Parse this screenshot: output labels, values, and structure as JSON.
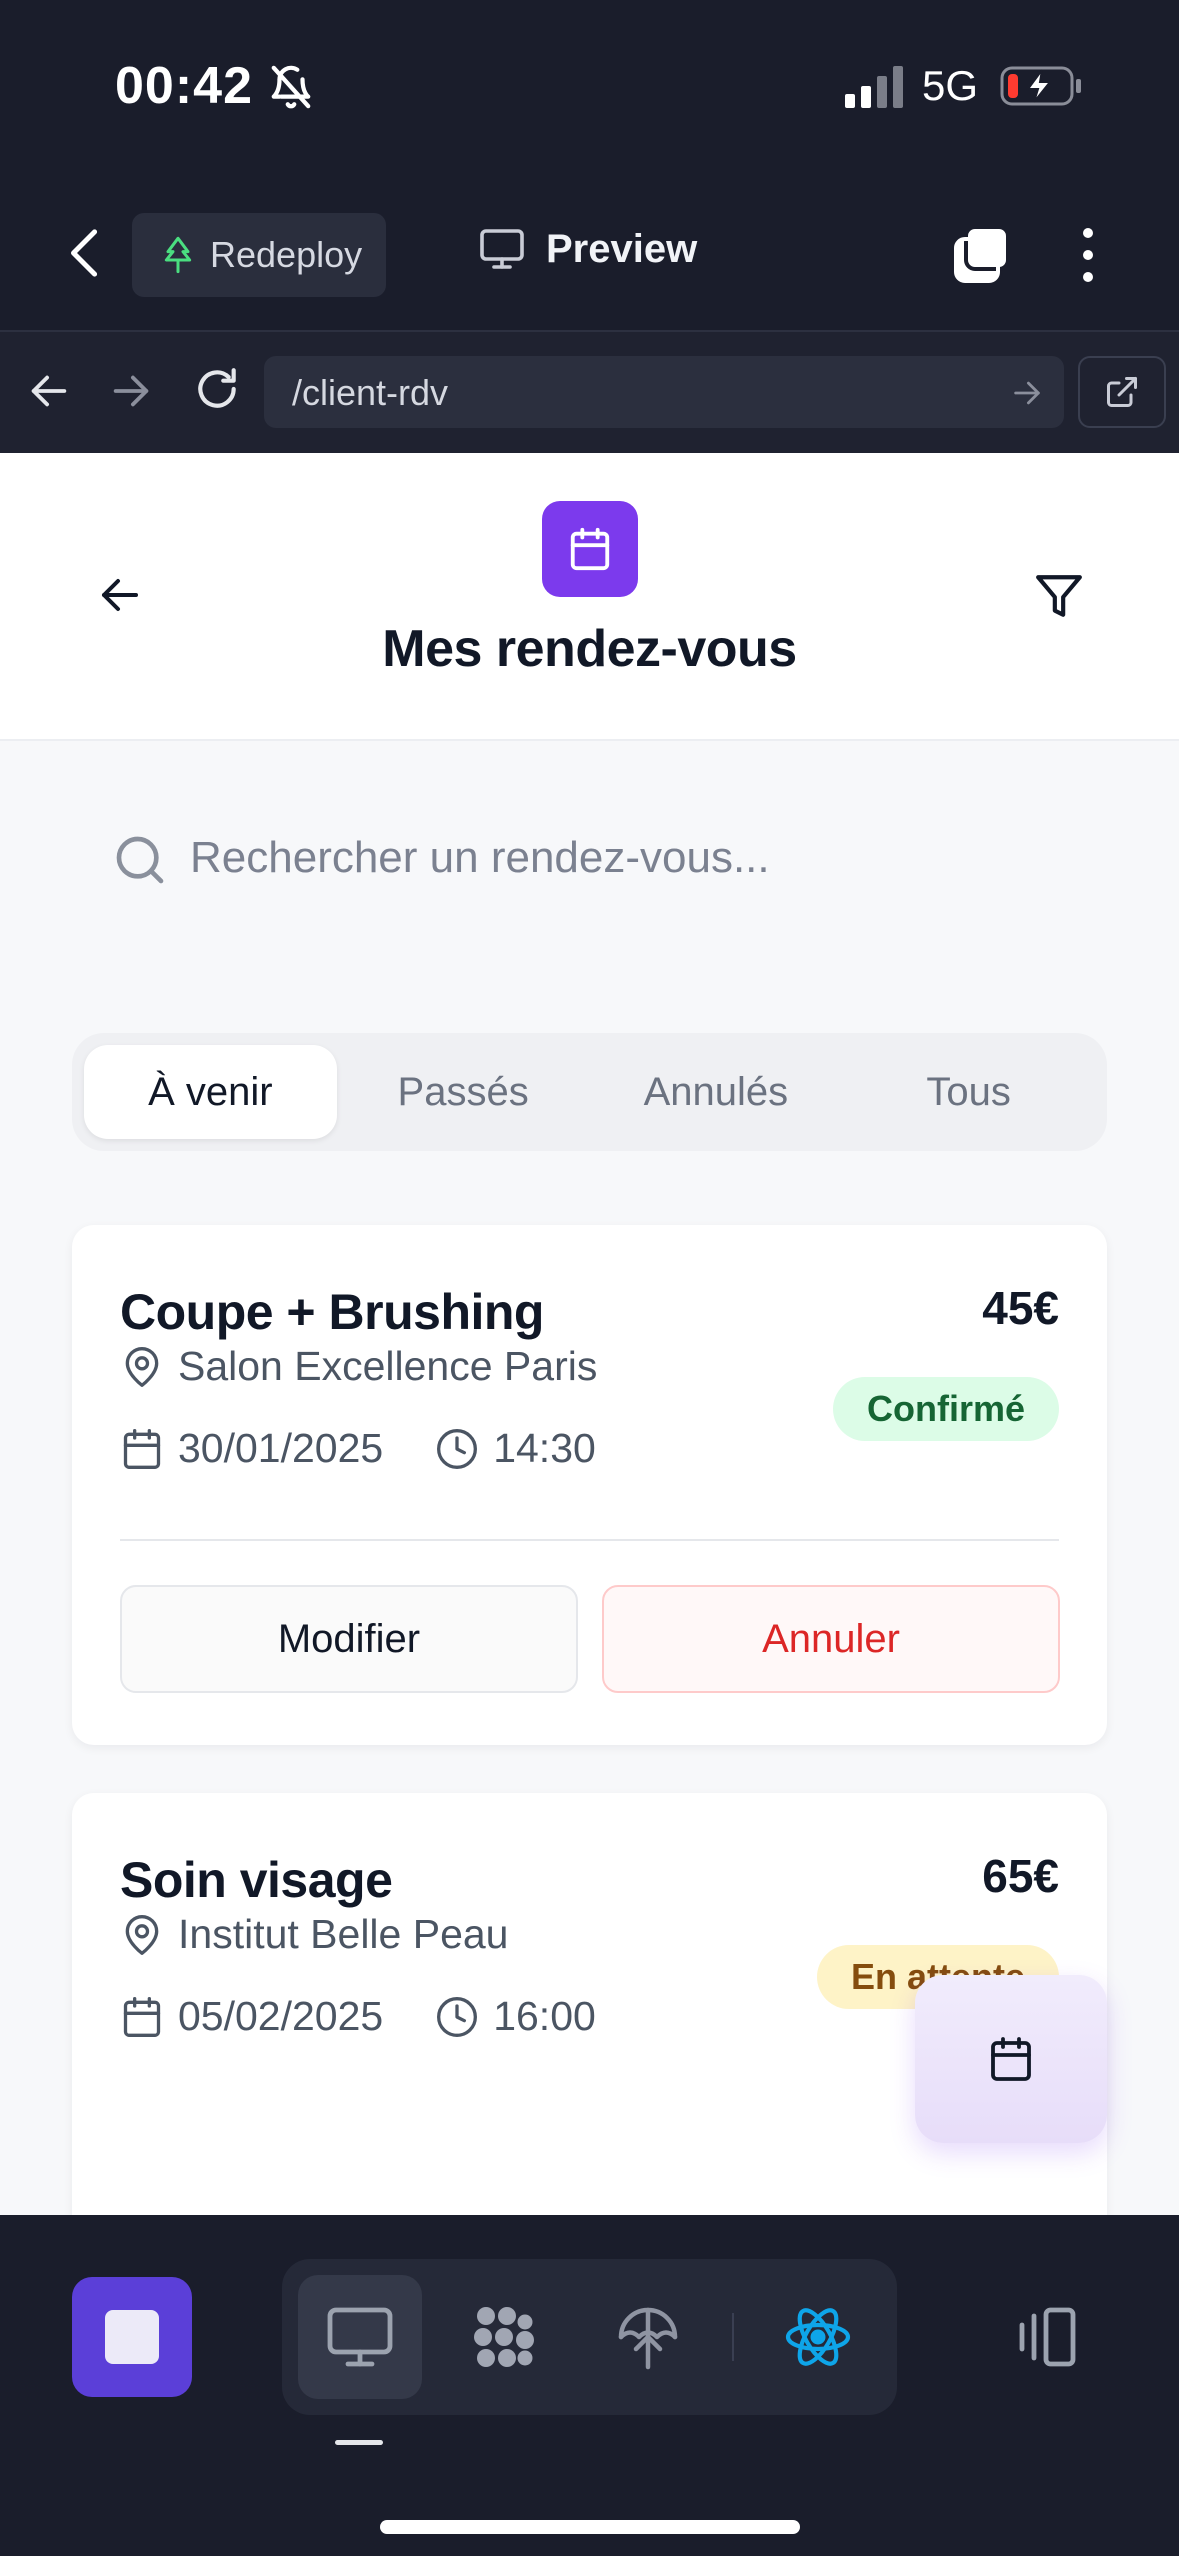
{
  "status_bar": {
    "time": "00:42",
    "network": "5G"
  },
  "toolbar": {
    "redeploy_label": "Redeploy",
    "preview_label": "Preview"
  },
  "address_bar": {
    "url": "/client-rdv"
  },
  "header": {
    "title": "Mes rendez-vous"
  },
  "search": {
    "placeholder": "Rechercher un rendez-vous..."
  },
  "tabs": [
    {
      "label": "À venir",
      "active": true
    },
    {
      "label": "Passés",
      "active": false
    },
    {
      "label": "Annulés",
      "active": false
    },
    {
      "label": "Tous",
      "active": false
    }
  ],
  "appointments": [
    {
      "service": "Coupe + Brushing",
      "price": "45€",
      "place": "Salon Excellence Paris",
      "date": "30/01/2025",
      "time": "14:30",
      "status": "Confirmé",
      "actions": {
        "modify": "Modifier",
        "cancel": "Annuler"
      }
    },
    {
      "service": "Soin visage",
      "price": "65€",
      "place": "Institut Belle Peau",
      "date": "05/02/2025",
      "time": "16:00",
      "status": "En attente"
    }
  ],
  "colors": {
    "brand": "#7c3aed",
    "confirmed_bg": "#dcfce7",
    "confirmed_text": "#166534",
    "pending_bg": "#fef3c7",
    "pending_text": "#854d0e",
    "danger": "#dc2626",
    "chrome_bg": "#1a1d2b"
  },
  "icons": {
    "status": [
      "bell-slash-icon",
      "signal-icon",
      "battery-charging-icon"
    ],
    "toolbar": [
      "chevron-left-icon",
      "tree-icon",
      "monitor-icon",
      "tabs-icon",
      "more-vertical-icon"
    ],
    "address": [
      "arrow-left-icon",
      "arrow-right-icon",
      "reload-icon",
      "arrow-go-icon",
      "external-link-icon"
    ],
    "page": [
      "arrow-left-icon",
      "calendar-icon",
      "filter-icon",
      "search-icon",
      "map-pin-icon",
      "clock-icon"
    ],
    "dock": [
      "stop-icon",
      "monitor-icon",
      "grid-dots-icon",
      "deploy-icon",
      "react-icon",
      "layout-panels-icon"
    ]
  }
}
